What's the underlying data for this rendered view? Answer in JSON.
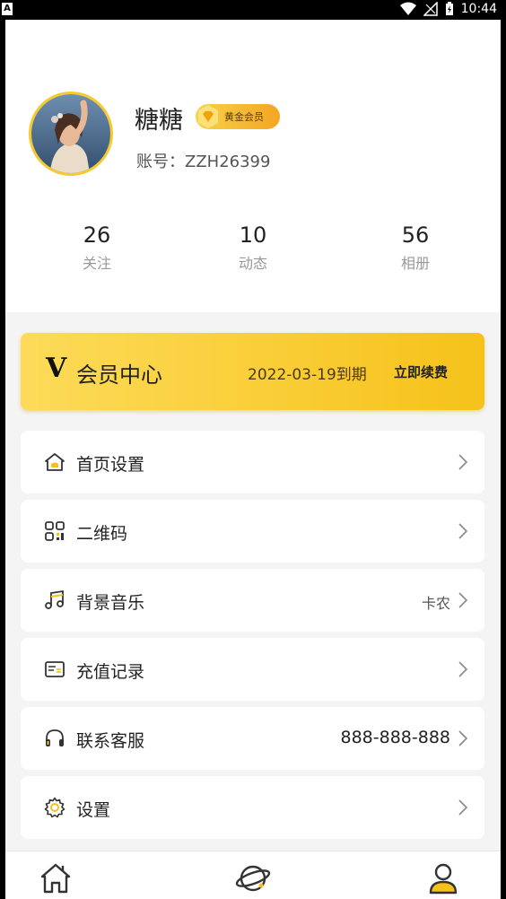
{
  "status_bar": {
    "left_badge": "A",
    "time": "10:44"
  },
  "profile": {
    "name": "糖糖",
    "badge_label": "黄金会员",
    "account": "账号：ZZH26399",
    "stats": [
      {
        "value": "26",
        "label": "关注"
      },
      {
        "value": "10",
        "label": "动态"
      },
      {
        "value": "56",
        "label": "相册"
      }
    ]
  },
  "vip_banner": {
    "logo": "V",
    "title": "会员中心",
    "expiry": "2022-03-19到期",
    "renew_label": "立即续费"
  },
  "menu": [
    {
      "icon": "home-settings-icon",
      "label": "首页设置",
      "value": ""
    },
    {
      "icon": "qrcode-icon",
      "label": "二维码",
      "value": ""
    },
    {
      "icon": "music-icon",
      "label": "背景音乐",
      "value": "卡农"
    },
    {
      "icon": "recharge-record-icon",
      "label": "充值记录",
      "value": ""
    },
    {
      "icon": "headset-icon",
      "label": "联系客服",
      "value": "888-888-888"
    },
    {
      "icon": "gear-icon",
      "label": "设置",
      "value": ""
    }
  ],
  "tabbar": {
    "tabs": [
      "home-tab-icon",
      "discover-planet-icon",
      "profile-tab-icon"
    ],
    "active_color": "#f6c21a"
  },
  "colors": {
    "accent": "#f6c21a",
    "background": "#f4f4f4"
  }
}
